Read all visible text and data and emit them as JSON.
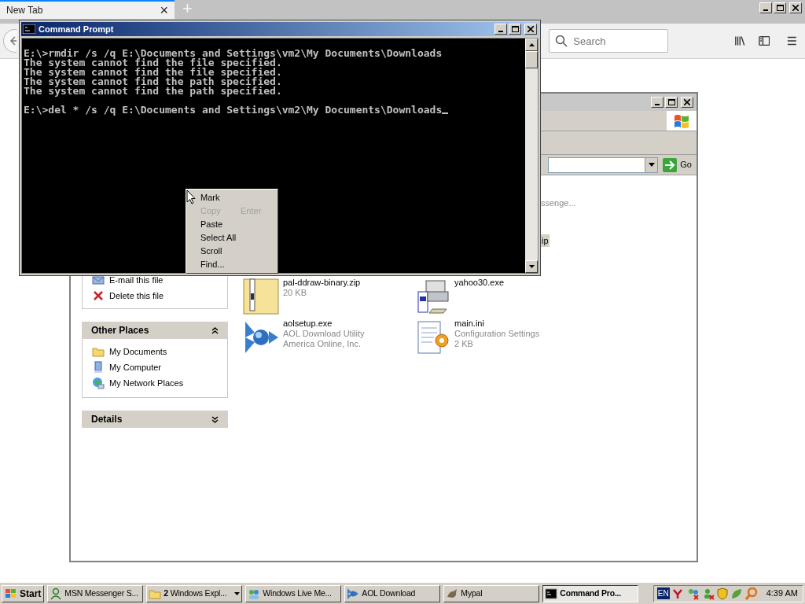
{
  "browser": {
    "tab": {
      "title": "New Tab",
      "close": "×"
    },
    "new_tab": "+",
    "search": {
      "placeholder": "Search"
    }
  },
  "explorer": {
    "go_button": "Go",
    "partial_items": [
      {
        "text": "ssenge...",
        "selected": false
      },
      {
        "text": "ip",
        "selected": true
      }
    ],
    "tasks": [
      {
        "label": "E-mail this file",
        "kind": "email"
      },
      {
        "label": "Delete this file",
        "kind": "delete"
      }
    ],
    "panels": [
      {
        "title": "Other Places",
        "expanded": true,
        "items": [
          {
            "label": "My Documents",
            "kind": "folder"
          },
          {
            "label": "My Computer",
            "kind": "computer"
          },
          {
            "label": "My Network Places",
            "kind": "network"
          }
        ]
      },
      {
        "title": "Details",
        "expanded": false
      }
    ],
    "files": [
      {
        "name": "pal-ddraw-binary.zip",
        "kind": "zip",
        "details": [
          "20 KB"
        ]
      },
      {
        "name": "yahoo30.exe",
        "kind": "installer"
      },
      {
        "name": "aolsetup.exe",
        "kind": "aol",
        "details": [
          "AOL Download Utility",
          "America Online, Inc."
        ]
      },
      {
        "name": "main.ini",
        "kind": "config",
        "details": [
          "Configuration Settings",
          "2 KB"
        ]
      }
    ]
  },
  "cmd": {
    "title": "Command Prompt",
    "output": [
      "E:\\>rmdir /s /q E:\\Documents and Settings\\vm2\\My Documents\\Downloads",
      "The system cannot find the file specified.",
      "The system cannot find the file specified.",
      "The system cannot find the path specified.",
      "The system cannot find the path specified."
    ],
    "prompt": "E:\\>del * /s /q E:\\Documents and Settings\\vm2\\My Documents\\Downloads",
    "context_menu": [
      {
        "label": "Mark",
        "disabled": false
      },
      {
        "label": "Copy",
        "shortcut": "Enter",
        "disabled": true
      },
      {
        "label": "Paste",
        "disabled": false
      },
      {
        "label": "Select All",
        "disabled": false
      },
      {
        "label": "Scroll",
        "disabled": false
      },
      {
        "label": "Find...",
        "disabled": false
      }
    ]
  },
  "taskbar": {
    "start": "Start",
    "buttons": [
      {
        "label": "MSN Messenger S...",
        "kind": "person",
        "selected": false
      },
      {
        "label": "Windows Expl...",
        "count": "2",
        "kind": "folder",
        "selected": false
      },
      {
        "label": "Windows Live Me...",
        "kind": "people",
        "selected": false
      },
      {
        "label": "AOL Download",
        "kind": "aol",
        "selected": false
      },
      {
        "label": "Mypal",
        "kind": "animal",
        "selected": false
      },
      {
        "label": "Command Pro...",
        "kind": "console",
        "selected": true
      }
    ],
    "language": "EN",
    "clock": "4:39 AM"
  }
}
